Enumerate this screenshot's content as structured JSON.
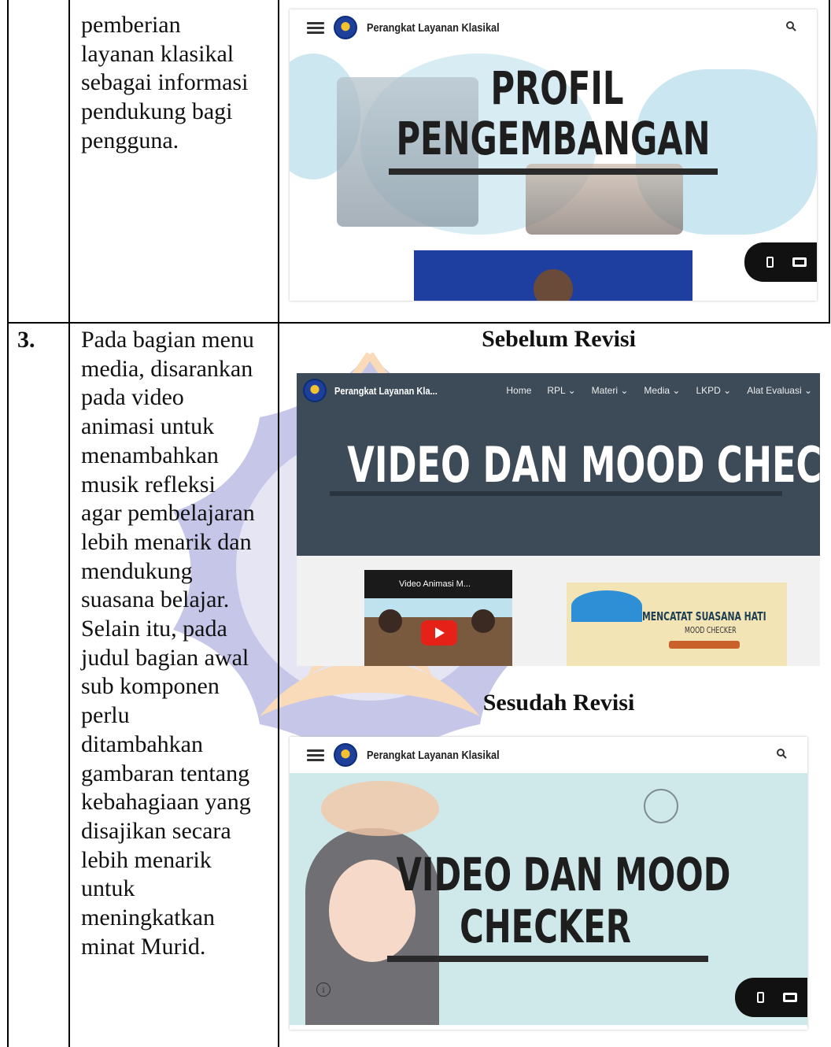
{
  "row_top": {
    "description_text": "pemberian\nlayanan klasikal\nsebagai informasi\npendukung bagi\npengguna.",
    "screenshot": {
      "site_title": "Perangkat Layanan Klasikal",
      "hero_title_line1": "PROFIL",
      "hero_title_line2": "PENGEMBANGAN"
    }
  },
  "row_3": {
    "number": "3.",
    "description_text": "Pada bagian menu\nmedia, disarankan\npada video\nanimasi untuk\nmenambahkan\nmusik refleksi\nagar pembelajaran\nlebih menarik dan\nmendukung\nsuasana belajar.\nSelain itu, pada\njudul bagian awal\nsub komponen\nperlu\nditambahkan\ngambaran tentang\nkebahagiaan yang\ndisajikan secara\nlebih menarik\nuntuk\nmeningkatkan\nminat Murid.",
    "before_heading": "Sebelum Revisi",
    "after_heading": "Sesudah Revisi",
    "before_screenshot": {
      "site_title": "Perangkat Layanan Kla...",
      "nav_items": [
        "Home",
        "RPL ⌄",
        "Materi ⌄",
        "Media ⌄",
        "LKPD ⌄",
        "Alat Evaluasi ⌄"
      ],
      "hero_title": "VIDEO DAN MOOD CHECKER",
      "video_caption": "Video Animasi M...",
      "card_title": "MENCATAT SUASANA HATI",
      "card_subtitle": "MOOD CHECKER"
    },
    "after_screenshot": {
      "site_title": "Perangkat Layanan Klasikal",
      "hero_title_line1": "VIDEO DAN MOOD",
      "hero_title_line2": "CHECKER",
      "info_icon": "i"
    }
  },
  "colors": {
    "before_banner": "#3d4a57",
    "after_banner": "#cfe8ea",
    "watermark_purple": "#6c6cc4",
    "watermark_orange": "#f1a24a"
  }
}
